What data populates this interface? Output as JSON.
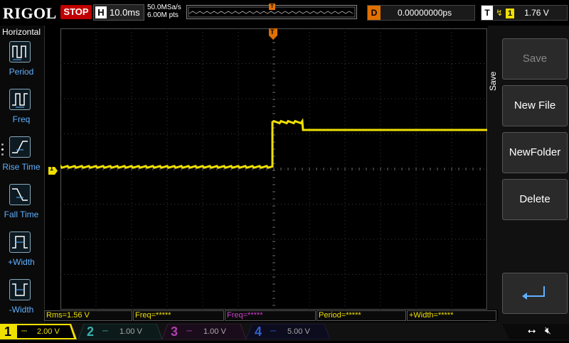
{
  "brand": {
    "logo": "RIGOL"
  },
  "topbar": {
    "run_state": "STOP",
    "horizontal_label": "H",
    "timebase": "10.0ms",
    "sample_rate": "50.0MSa/s",
    "memory_depth": "6.00M pts",
    "delay_label": "D",
    "delay_value": "0.00000000ps",
    "trigger_label": "T",
    "trigger_source": "1",
    "trigger_level": "1.76 V"
  },
  "left_menu": {
    "title": "Horizontal",
    "items": [
      {
        "label": "Period",
        "icon": "period-icon"
      },
      {
        "label": "Freq",
        "icon": "frequency-icon"
      },
      {
        "label": "Rise Time",
        "icon": "rise-time-icon"
      },
      {
        "label": "Fall Time",
        "icon": "fall-time-icon"
      },
      {
        "label": "+Width",
        "icon": "positive-width-icon"
      },
      {
        "label": "-Width",
        "icon": "negative-width-icon"
      }
    ]
  },
  "right_menu": {
    "title": "Save",
    "buttons": [
      {
        "label": "Save",
        "enabled": false
      },
      {
        "label": "New File",
        "enabled": true
      },
      {
        "label": "NewFolder",
        "enabled": true
      },
      {
        "label": "Delete",
        "enabled": true
      }
    ],
    "return_icon": "return-arrow-icon"
  },
  "measurements": [
    {
      "text": "Rms=1.56 V",
      "color": "#f0e000"
    },
    {
      "text": "Freq=*****",
      "color": "#f0e000"
    },
    {
      "text": "Freq=*****",
      "color": "#d040d0"
    },
    {
      "text": "Period=*****",
      "color": "#f0e000"
    },
    {
      "text": "+Width=*****",
      "color": "#f0e000"
    }
  ],
  "channels": [
    {
      "num": "1",
      "scale": "2.00 V",
      "color": "#f0e000",
      "active": true
    },
    {
      "num": "2",
      "scale": "1.00 V",
      "color": "#3cb0b0",
      "active": false
    },
    {
      "num": "3",
      "scale": "1.00 V",
      "color": "#b040b0",
      "active": false
    },
    {
      "num": "4",
      "scale": "5.00 V",
      "color": "#3060d0",
      "active": false
    }
  ],
  "markers": {
    "ch1": "1",
    "trigger": "T"
  },
  "colors": {
    "ch1": "#f0e000",
    "trigger": "#e07000",
    "grid": "#3a3a3a"
  },
  "status_icons": [
    "usb-icon",
    "speaker-muted-icon"
  ]
}
